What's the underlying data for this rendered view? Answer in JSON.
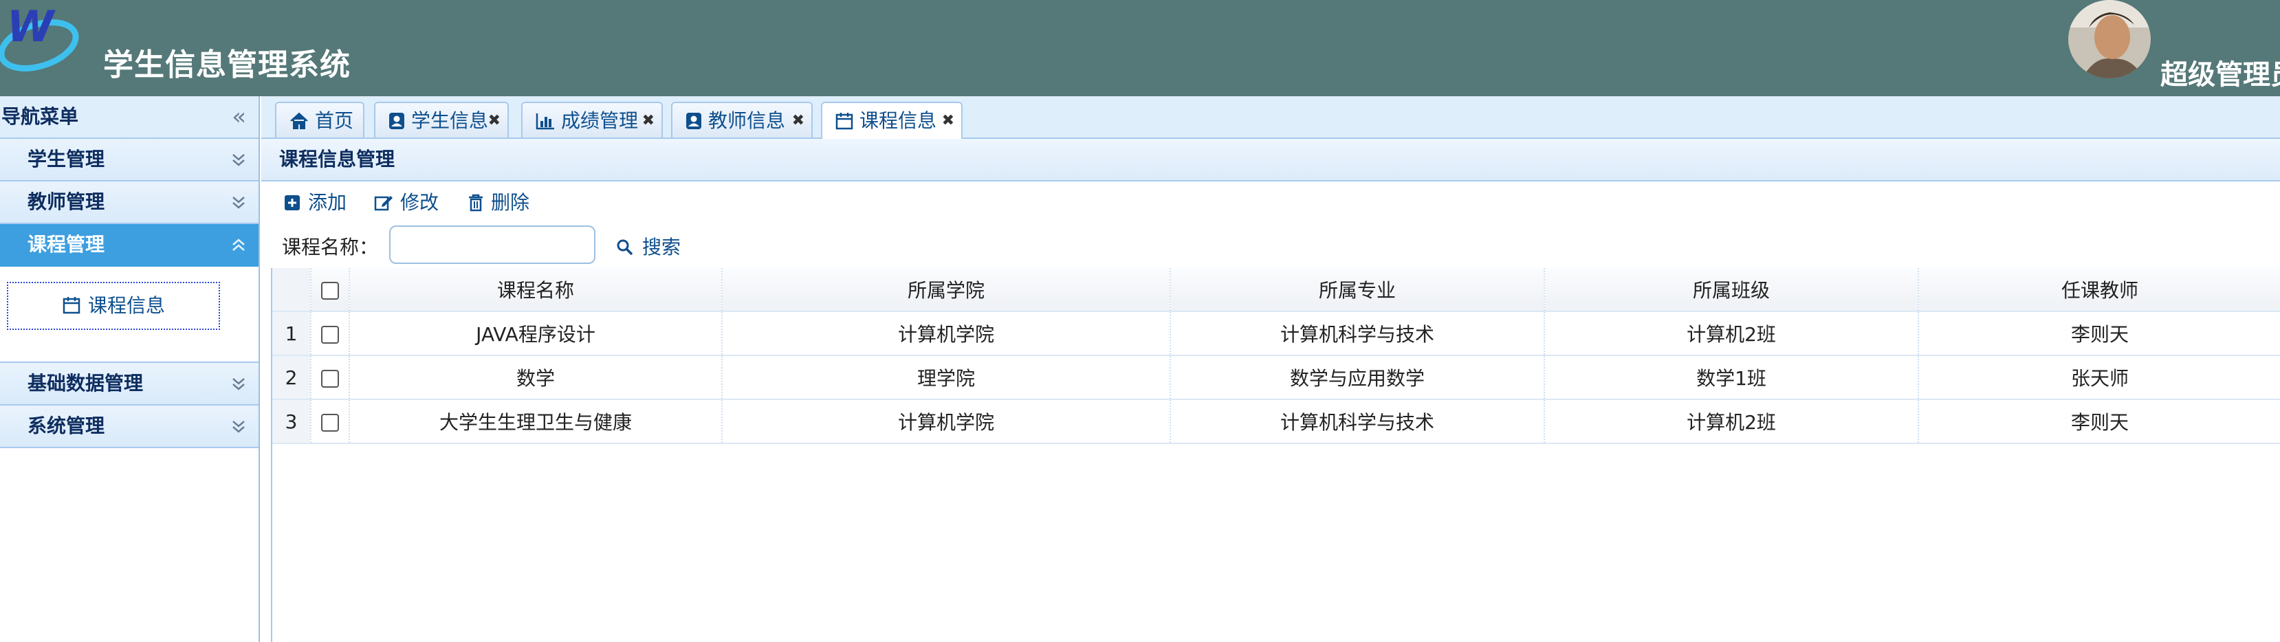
{
  "header": {
    "title": "学生信息管理系统",
    "user": "超级管理员",
    "logo_icon": "w-logo-icon",
    "background": "#557878"
  },
  "sidebar": {
    "title": "导航菜单",
    "groups": [
      {
        "label": "学生管理",
        "expanded": false
      },
      {
        "label": "教师管理",
        "expanded": false
      },
      {
        "label": "课程管理",
        "expanded": true,
        "items": [
          {
            "label": "课程信息",
            "icon": "calendar-icon"
          }
        ]
      },
      {
        "label": "基础数据管理",
        "expanded": false
      },
      {
        "label": "系统管理",
        "expanded": false
      }
    ]
  },
  "tabs": [
    {
      "label": "首页",
      "icon": "home-icon",
      "closable": false
    },
    {
      "label": "学生信息",
      "icon": "user-card-icon",
      "closable": true
    },
    {
      "label": "成绩管理",
      "icon": "bar-chart-icon",
      "closable": true
    },
    {
      "label": "教师信息",
      "icon": "user-card-icon",
      "closable": true
    },
    {
      "label": "课程信息",
      "icon": "calendar-icon",
      "closable": true,
      "active": true
    }
  ],
  "panel": {
    "title": "课程信息管理"
  },
  "toolbar": {
    "add": "添加",
    "edit": "修改",
    "delete": "删除"
  },
  "search": {
    "label": "课程名称：",
    "value": "",
    "button": "搜索"
  },
  "table": {
    "columns": [
      "课程名称",
      "所属学院",
      "所属专业",
      "所属班级",
      "任课教师"
    ],
    "rows": [
      {
        "num": "1",
        "cells": [
          "JAVA程序设计",
          "计算机学院",
          "计算机科学与技术",
          "计算机2班",
          "李则天"
        ]
      },
      {
        "num": "2",
        "cells": [
          "数学",
          "理学院",
          "数学与应用数学",
          "数学1班",
          "张天师"
        ]
      },
      {
        "num": "3",
        "cells": [
          "大学生生理卫生与健康",
          "计算机学院",
          "计算机科学与技术",
          "计算机2班",
          "李则天"
        ]
      }
    ]
  },
  "colors": {
    "accent": "#3d9fe0",
    "link": "#0e4f8d",
    "border": "#a8c9ec"
  }
}
